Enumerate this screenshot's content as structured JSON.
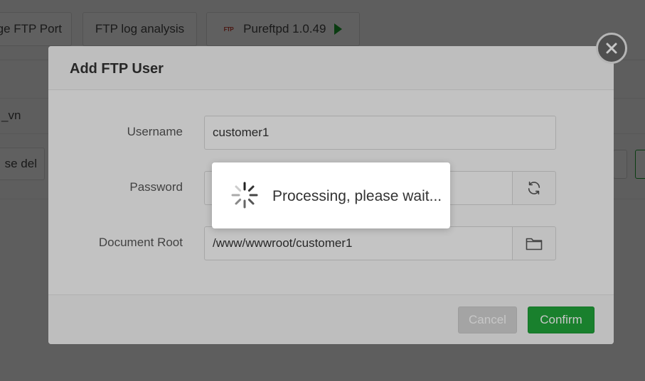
{
  "background": {
    "toolbar": {
      "change_port_label": "ge FTP Port",
      "log_analysis_label": "FTP log analysis",
      "ftp_logo_text": "FTP",
      "service_label": "Pureftpd 1.0.49",
      "service_status_color": "#1a9b2f"
    },
    "row_domain": "_vn",
    "batch_delete_label": "se del"
  },
  "dialog": {
    "title": "Add FTP User",
    "fields": {
      "username": {
        "label": "Username",
        "value": "customer1"
      },
      "password": {
        "label": "Password",
        "value": ""
      },
      "document_root": {
        "label": "Document Root",
        "value": "/www/wwwroot/customer1"
      }
    },
    "cancel_label": "Cancel",
    "confirm_label": "Confirm",
    "confirm_color": "#20a53a"
  },
  "loading": {
    "message": "Processing, please wait..."
  },
  "icons": {
    "close": "close-icon",
    "refresh": "refresh-icon",
    "folder": "folder-icon",
    "spinner": "spinner-icon",
    "play": "play-icon"
  }
}
